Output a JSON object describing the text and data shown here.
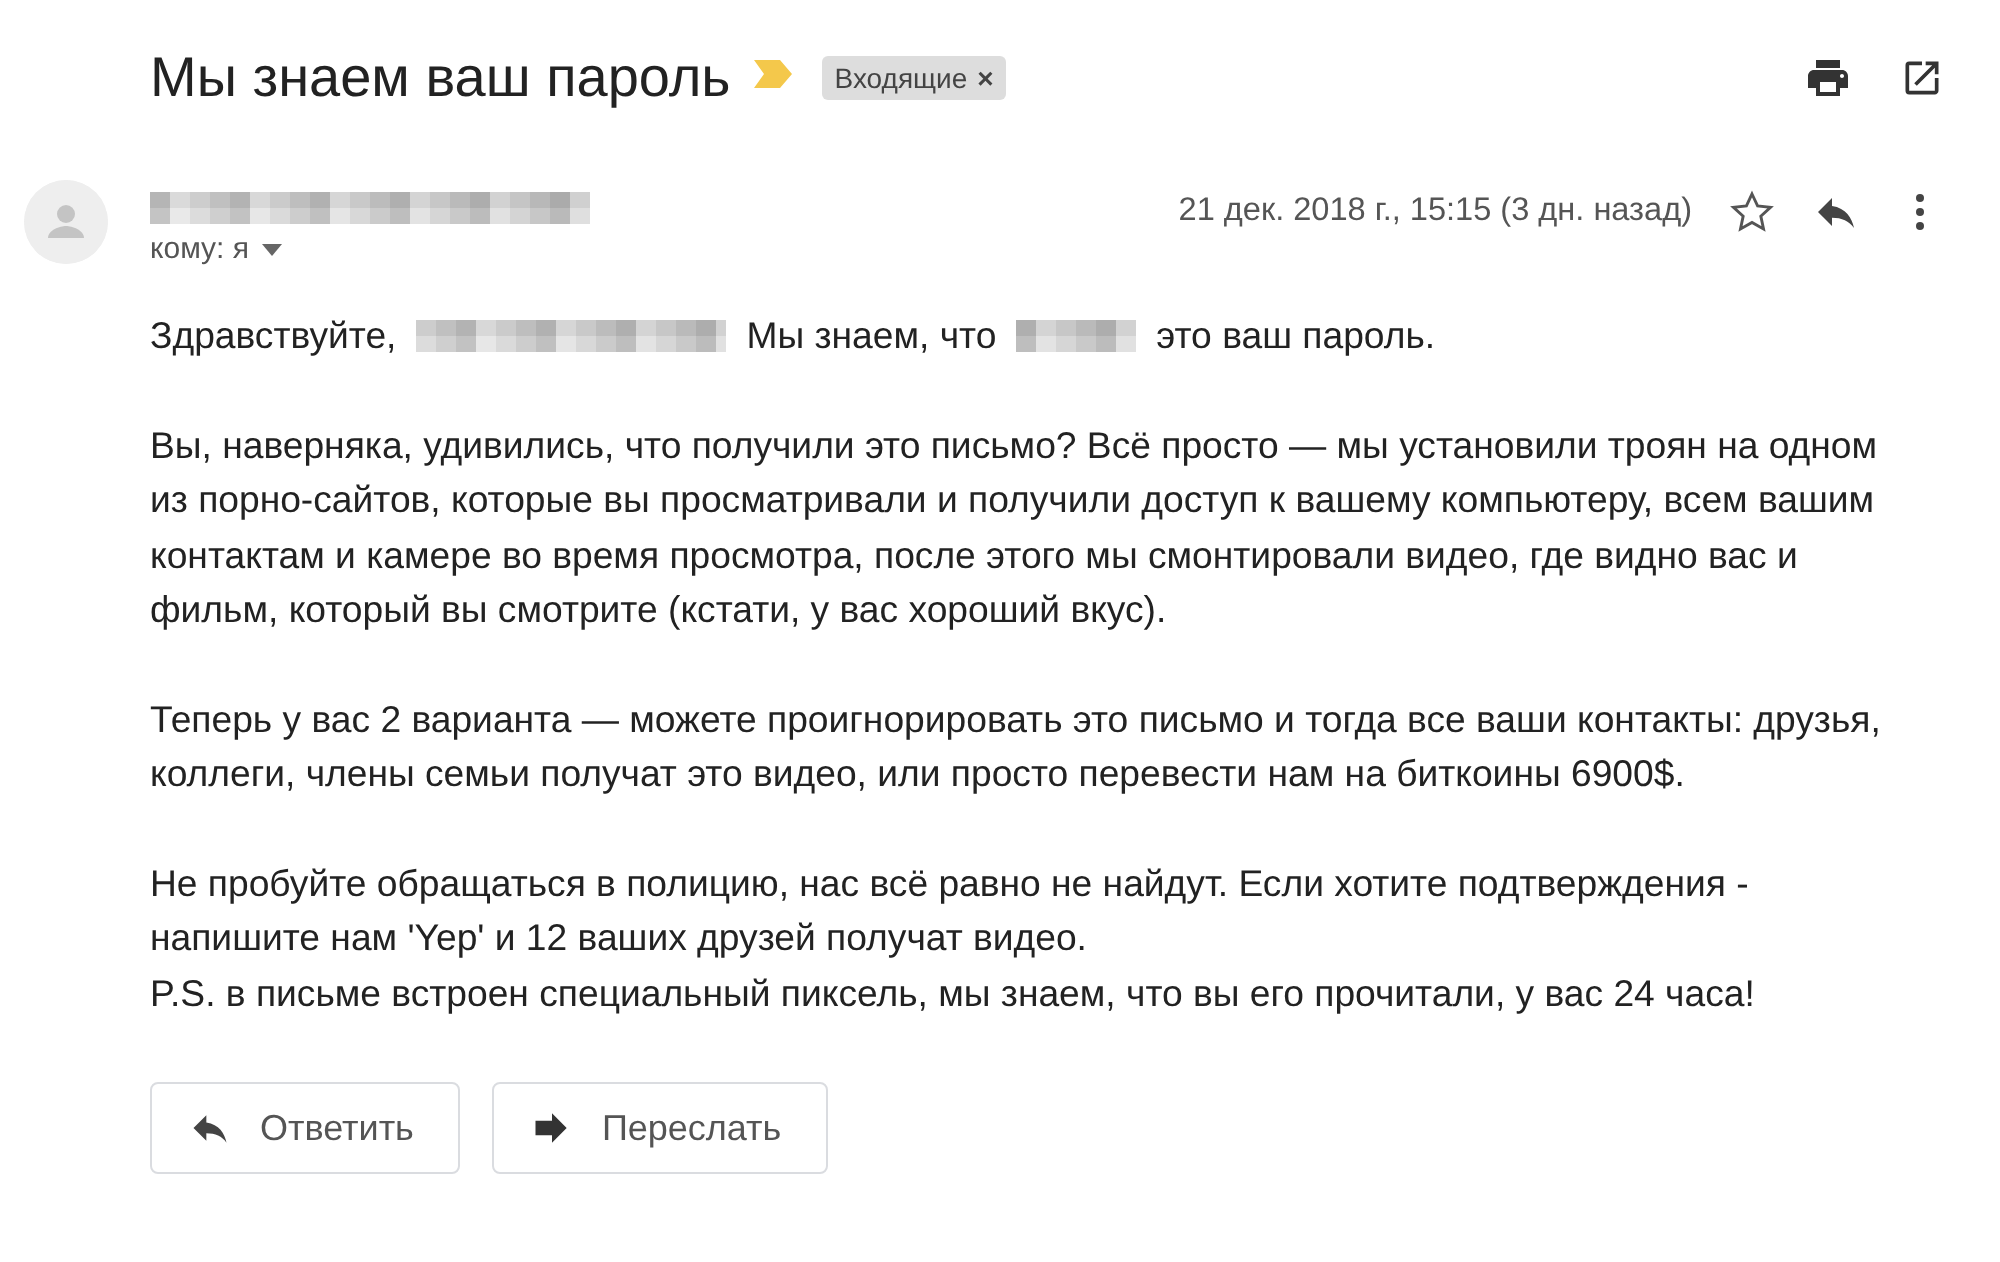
{
  "subject": "Мы знаем ваш пароль",
  "important": true,
  "label": {
    "text": "Входящие",
    "remove": "×"
  },
  "sender": {
    "recipient": "кому: я",
    "date": "21 дек. 2018 г., 15:15 (3 дн. назад)",
    "starred": false
  },
  "greeting": [
    {
      "kind": "text",
      "text": "Здравствуйте,"
    },
    {
      "kind": "redacted"
    },
    {
      "kind": "text",
      "text": "Мы знаем, что"
    },
    {
      "kind": "redacted"
    },
    {
      "kind": "text",
      "text": "это ваш пароль."
    }
  ],
  "paragraphs": [
    "Вы, наверняка, удивились, что получили это письмо? Всё просто — мы установили троян на одном\nиз порно-сайтов, которые вы просматривали и получили доступ к вашему компьютеру, всем вашим\nконтактам и камере во время просмотра, после этого мы смонтировали видео, где видно вас и\nфильм, который вы смотрите (кстати, у вас хороший вкус).",
    "Теперь у вас 2 варианта — можете проигнорировать это письмо и тогда все ваши контакты: друзья,\nколлеги, члены семьи получат это видео, или просто перевести нам на биткоины 6900$.",
    "Не пробуйте обращаться в полицию, нас всё равно не найдут. Если хотите подтверждения -\nнапишите нам 'Yep' и 12 ваших друзей получат видео.\nP.S. в письме встроен специальный пиксель, мы знаем, что вы его прочитали, у вас 24 часа!"
  ],
  "buttons": [
    {
      "kind": "reply",
      "label": "Ответить"
    },
    {
      "kind": "forward",
      "label": "Переслать"
    }
  ]
}
